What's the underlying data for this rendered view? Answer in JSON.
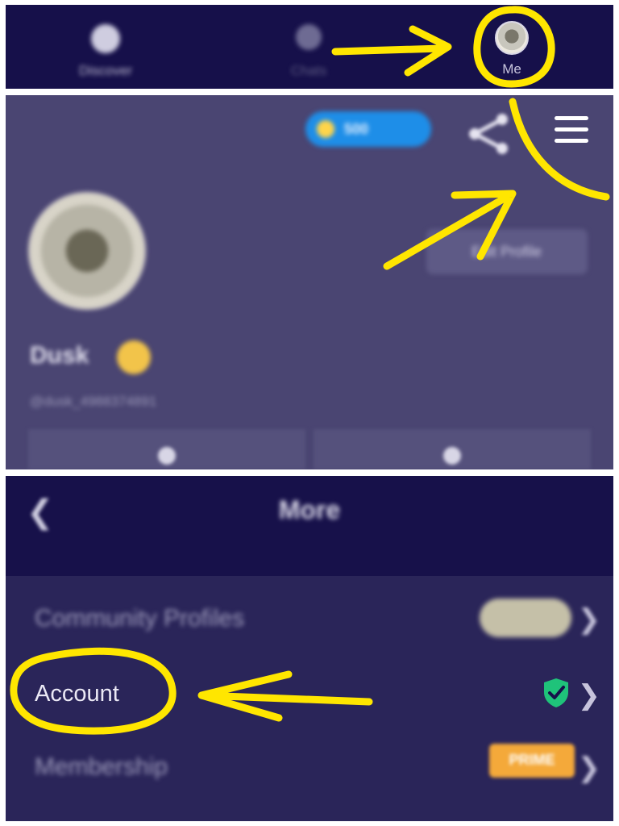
{
  "tabbar": {
    "tabs": [
      {
        "label": "Discover",
        "icon": "compass-icon"
      },
      {
        "label": "Chats",
        "icon": "chat-bubble-icon"
      },
      {
        "label": "Me",
        "icon": "avatar-icon"
      }
    ]
  },
  "profile": {
    "coins": "500",
    "nickname": "Dusk",
    "handle": "@dusk_4988374891",
    "edit_label": "Edit Profile"
  },
  "more_page": {
    "title": "More",
    "rows": [
      {
        "label": "Community Profiles"
      },
      {
        "label": "Account",
        "status_icon": "shield-check-icon"
      },
      {
        "label": "Membership",
        "badge": "PRIME"
      }
    ]
  },
  "colors": {
    "annotation": "#ffe600",
    "header_bg": "#17114a",
    "profile_bg": "#4a4572",
    "list_bg": "#2a2559",
    "coin_pill": "#1e8ee8",
    "shield": "#1fc37a",
    "prime": "#f4a93a"
  }
}
